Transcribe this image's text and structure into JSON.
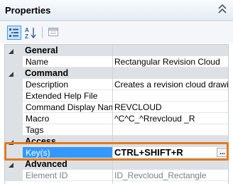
{
  "panel": {
    "title": "Properties"
  },
  "colors": {
    "accent": "#3399ff",
    "highlight": "#e07b20",
    "category_bg": "#dde1e6"
  },
  "toolbar": {
    "categorized_icon": "categorized-icon",
    "alphabetical_icon": "alphabetical-icon",
    "property_pages_icon": "property-pages-icon"
  },
  "grid": {
    "categories": {
      "general": "General",
      "command": "Command",
      "access": "Access",
      "advanced": "Advanced"
    },
    "general": [
      {
        "name": "Name",
        "value": "Rectangular Revision Cloud"
      }
    ],
    "command": [
      {
        "name": "Description",
        "value": "Creates a revision cloud drawing a"
      },
      {
        "name": "Extended Help File",
        "value": ""
      },
      {
        "name": "Command Display Name",
        "value": "REVCLOUD"
      },
      {
        "name": "Macro",
        "value": "^C^C_^Rrevcloud _R"
      },
      {
        "name": "Tags",
        "value": ""
      }
    ],
    "access": [
      {
        "name": "Key(s)",
        "value": "CTRL+SHIFT+R",
        "button": "..."
      }
    ],
    "advanced": [
      {
        "name": "Element ID",
        "value": "ID_Revcloud_Rectangle"
      }
    ]
  }
}
